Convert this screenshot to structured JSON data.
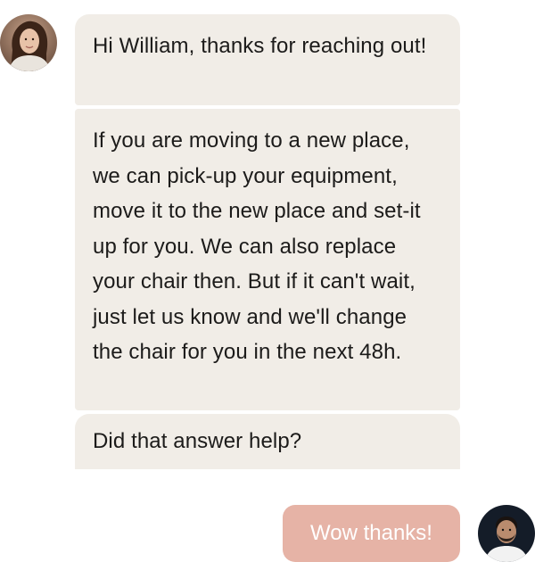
{
  "conversation": {
    "agent": {
      "avatar_icon": "woman-portrait-avatar",
      "messages": [
        "Hi William, thanks for reaching out!",
        "If you are moving to a new place, we can pick-up your equipment, move it to the new place and set-it up for you. We can also replace your chair then. But if it can't wait, just let us know and we'll change the chair for you in the next 48h.",
        "Did that answer help?"
      ]
    },
    "user": {
      "avatar_icon": "man-portrait-avatar",
      "reply": "Wow thanks!"
    }
  },
  "colors": {
    "agent_bubble": "#f1ede7",
    "user_bubble": "#e6b3a6",
    "user_bubble_text": "#ffffff",
    "text": "#1c1b1a"
  }
}
